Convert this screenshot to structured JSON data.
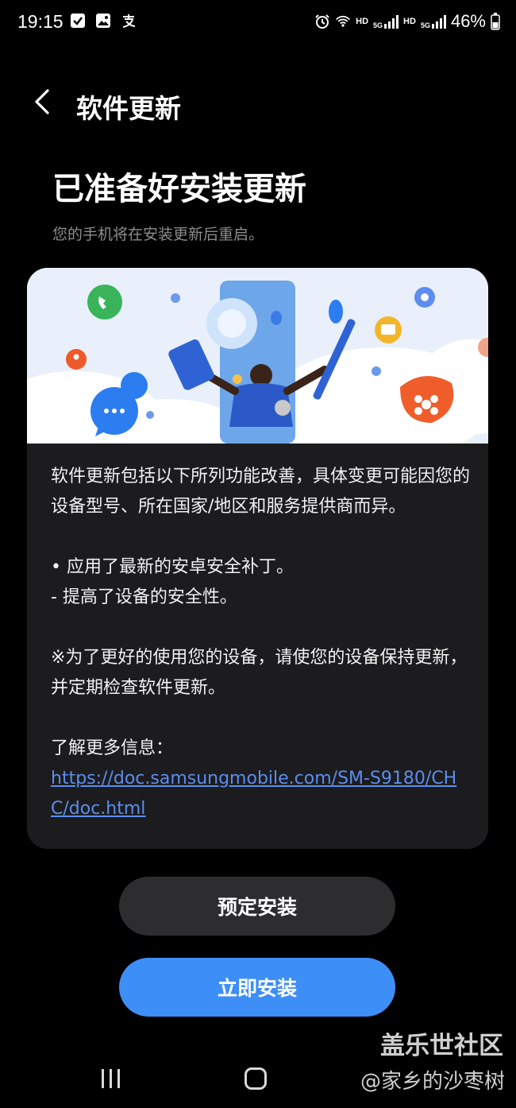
{
  "status_bar": {
    "time": "19:15",
    "left_icons": [
      "checkbox-icon",
      "gallery-icon",
      "alipay-icon"
    ],
    "right_icons": [
      "alarm-icon",
      "wifi-icon",
      "signal-icon",
      "signal-icon"
    ],
    "hd_label_1": "HD",
    "hd_label_2": "HD",
    "net_label_1": "5G",
    "net_label_2": "5G",
    "battery": "46%"
  },
  "header": {
    "back_icon": "chevron-left-icon",
    "title": "软件更新"
  },
  "main": {
    "headline": "已准备好安装更新",
    "subline": "您的手机将在安装更新后重启。"
  },
  "card": {
    "intro": "软件更新包括以下所列功能改善，具体变更可能因您的设备型号、所在国家/地区和服务提供商而异。",
    "bullets": "• 应用了最新的安卓安全补丁。\n - 提高了设备的安全性。",
    "note": "※为了更好的使用您的设备，请使您的设备保持更新，并定期检查软件更新。",
    "more_info_label": "了解更多信息：",
    "more_info_link": "https://doc.samsungmobile.com/SM-S9180/CHC/doc.html"
  },
  "buttons": {
    "schedule": "预定安装",
    "install_now": "立即安装"
  },
  "watermark": {
    "site": "盖乐世社区",
    "user": "@家乡的沙枣树"
  },
  "colors": {
    "background": "#000000",
    "card": "#1c1c1e",
    "primary_button": "#3e8ef7",
    "secondary_button": "#2d2d2f",
    "link": "#5b8def"
  }
}
